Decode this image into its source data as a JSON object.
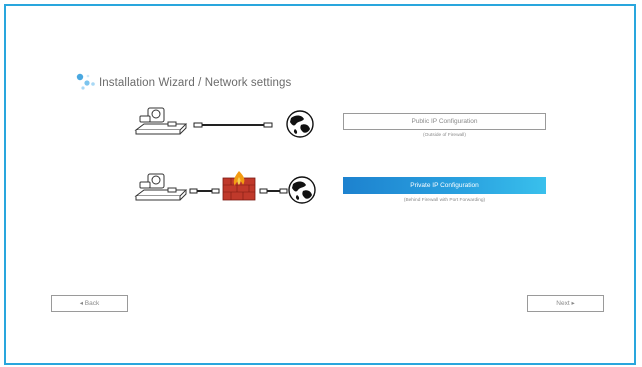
{
  "wizard": {
    "title": "Installation Wizard / Network settings",
    "options": [
      {
        "label": "Public IP Configuration",
        "sub": "(Outside of Firewall)",
        "selected": false
      },
      {
        "label": "Private IP Configuration",
        "sub": "(Behind Firewall with Port Forwarding)",
        "selected": true
      }
    ],
    "back_label": "◂ Back",
    "next_label": "Next ▸"
  },
  "colors": {
    "frame_border": "#29a6dd",
    "selected_start": "#1d82cf",
    "selected_end": "#39c0ec",
    "firewall": "#c0392b"
  },
  "icons": [
    "wizard-icon",
    "camera-device-icon",
    "ethernet-cable-icon",
    "firewall-icon",
    "globe-icon"
  ]
}
